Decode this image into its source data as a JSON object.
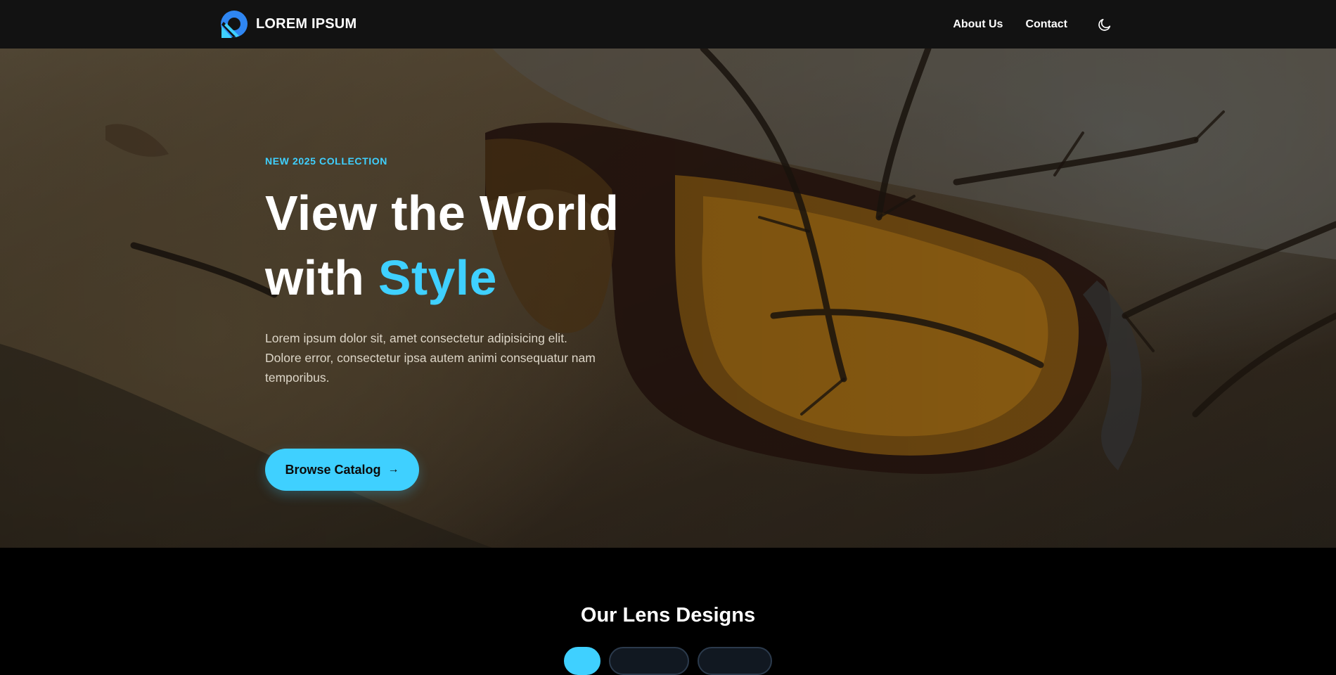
{
  "navbar": {
    "brand_name": "LOREM IPSUM",
    "links": [
      {
        "label": "About Us"
      },
      {
        "label": "Contact"
      }
    ],
    "theme_toggle_icon": "moon-icon"
  },
  "hero": {
    "eyebrow": "NEW 2025 COLLECTION",
    "title_line1": "View the World",
    "title_line2_prefix": "with ",
    "title_line2_accent": "Style",
    "description": "Lorem ipsum dolor sit, amet consectetur adipisicing elit. Dolore error, consectetur ipsa autem animi consequatur nam temporibus.",
    "cta_label": "Browse Catalog",
    "cta_icon": "arrow-right-icon",
    "background_image": "sunglasses-on-sand-photo"
  },
  "section": {
    "title": "Our Lens Designs"
  },
  "colors": {
    "accent": "#3fd0ff",
    "navbar_bg": "#121212",
    "page_bg": "#000000",
    "text": "#ffffff"
  }
}
